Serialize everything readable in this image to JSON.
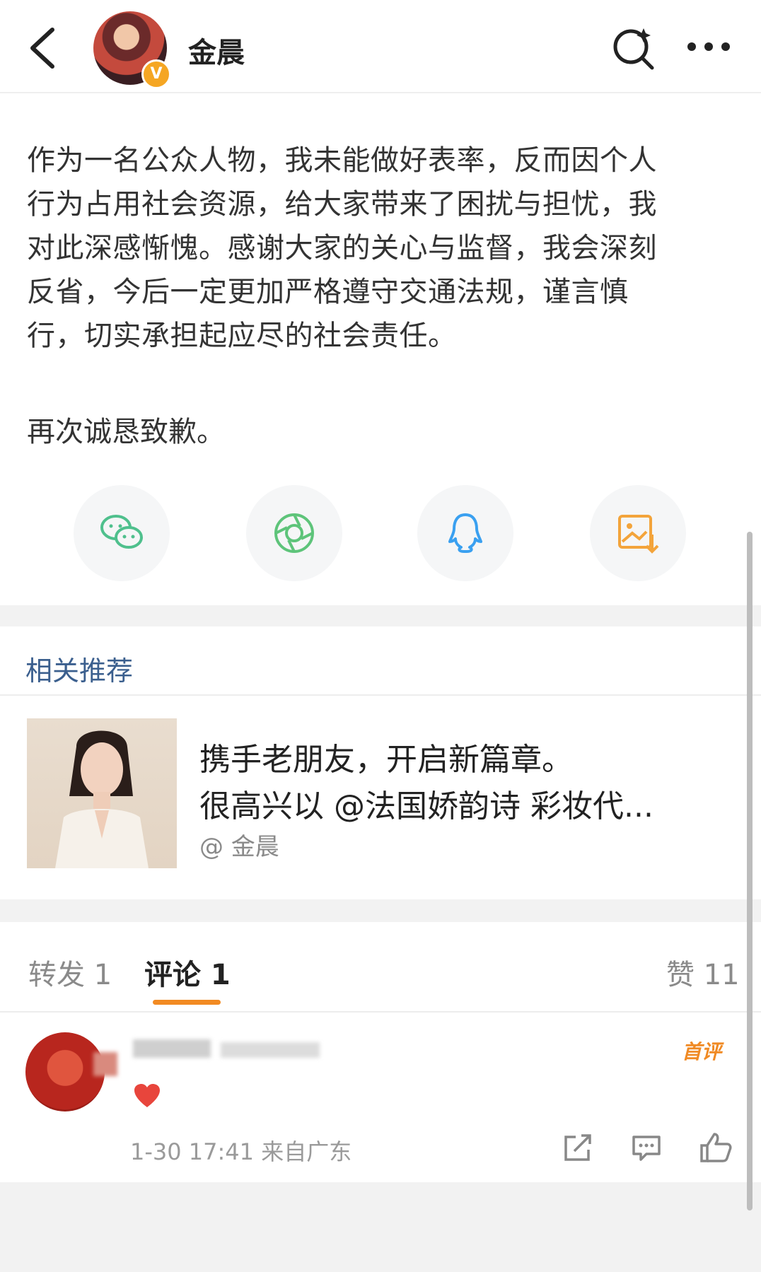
{
  "header": {
    "username": "金晨",
    "verified_badge": "V"
  },
  "post": {
    "paragraph1": "作为一名公众人物，我未能做好表率，反而因个人\n行为占用社会资源，给大家带来了困扰与担忧，我\n对此深感惭愧。感谢大家的关心与监督，我会深刻\n反省，今后一定更加严格遵守交通法规，谨言慎\n行，切实承担起应尽的社会责任。",
    "paragraph2": "再次诚恳致歉。"
  },
  "share": {
    "items": [
      "wechat-icon",
      "moments-icon",
      "qq-icon",
      "save-image-icon"
    ],
    "colors": {
      "wechat": "#4fc08d",
      "moments": "#5ec47a",
      "qq": "#3aa0f0",
      "save": "#f3a43b"
    }
  },
  "related": {
    "title": "相关推荐",
    "item": {
      "line1": "携手老朋友，开启新篇章。",
      "line2": "很高兴以 @法国娇韵诗 彩妆代...",
      "source": "@ 金晨"
    }
  },
  "tabs": {
    "repost": "转发 1",
    "comment": "评论 1",
    "like": "赞 11"
  },
  "comment": {
    "first_badge": "首评",
    "meta": "1-30 17:41 来自广东"
  },
  "colors": {
    "accent": "#f28a22",
    "link": "#3b5f8e",
    "badge": "#f5a623"
  }
}
